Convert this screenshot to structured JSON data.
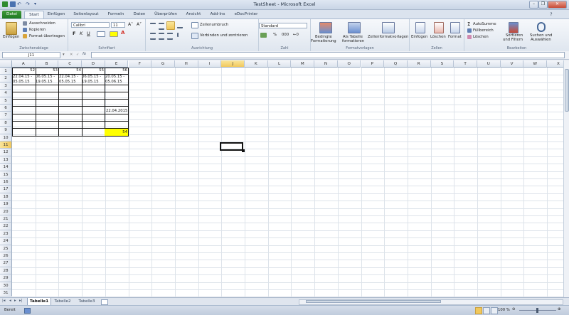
{
  "window": {
    "title": "TestSheet - Microsoft Excel"
  },
  "tabs": [
    "Datei",
    "Start",
    "Einfügen",
    "Seitenlayout",
    "Formeln",
    "Daten",
    "Überprüfen",
    "Ansicht",
    "Add-Ins",
    "eDocPrinter"
  ],
  "ribbon": {
    "clipboard": {
      "label": "Zwischenablage",
      "paste": "Einfügen",
      "cut": "Ausschneiden",
      "copy": "Kopieren",
      "format_painter": "Format übertragen"
    },
    "font": {
      "label": "Schriftart",
      "name": "Calibri",
      "size": "11",
      "bold": "F",
      "italic": "K",
      "underline": "U"
    },
    "alignment": {
      "label": "Ausrichtung",
      "wrap": "Zeilenumbruch",
      "merge": "Verbinden und zentrieren"
    },
    "number": {
      "label": "Zahl",
      "format": "Standard",
      "percent": "%",
      "thousands": "000"
    },
    "styles": {
      "label": "Formatvorlagen",
      "cond1": "Bedingte",
      "cond2": "Formatierung",
      "table1": "Als Tabelle",
      "table2": "formatieren",
      "cell": "Zellenformatvorlagen"
    },
    "cells": {
      "label": "Zellen",
      "insert": "Einfügen",
      "delete": "Löschen",
      "format": "Format"
    },
    "editing": {
      "label": "Bearbeiten",
      "autosum": "AutoSumme",
      "fill": "Füllbereich",
      "clear": "Löschen",
      "sort1": "Sortieren",
      "sort2": "und Filtern",
      "find1": "Suchen und",
      "find2": "Auswählen"
    }
  },
  "formula_bar": {
    "name_box": "J11",
    "fx": "fx",
    "content": ""
  },
  "columns": [
    "A",
    "B",
    "C",
    "D",
    "E",
    "F",
    "G",
    "H",
    "I",
    "J",
    "K",
    "L",
    "M",
    "N",
    "O",
    "P",
    "Q",
    "R",
    "S",
    "T",
    "U",
    "V",
    "W",
    "X"
  ],
  "selected_column": "J",
  "rows": [
    "1",
    "2",
    "3",
    "4",
    "5",
    "6",
    "7",
    "8",
    "9",
    "10",
    "11",
    "12",
    "13",
    "14",
    "15",
    "16",
    "17",
    "18",
    "19",
    "20",
    "21",
    "22",
    "23",
    "24",
    "25",
    "26",
    "27",
    "28",
    "29",
    "30",
    "31"
  ],
  "selected_row": "11",
  "cells": {
    "a1": "52",
    "b1": "53",
    "c1": "54",
    "d1": "55",
    "e1": "56",
    "a2_1": "22.04.15 -",
    "a2_2": "05.05.15",
    "b2_1": "06.05.15 -",
    "b2_2": "19.05.15",
    "c2_1": "22.04.15 -",
    "c2_2": "05.05.15",
    "d2_1": "06.05.15 -",
    "d2_2": "19.05.15",
    "e2_1": "20.05.15 -",
    "e2_2": "05.06.15",
    "e6": "22.04.2015",
    "e9": "54"
  },
  "colors": {
    "highlight": "#ffff00",
    "selection_header": "#f1c85c",
    "file_tab": "#2f8a2e"
  },
  "sheet_tabs": [
    "Tabelle1",
    "Tabelle2",
    "Tabelle3"
  ],
  "active_sheet": "Tabelle1",
  "status": {
    "ready": "Bereit",
    "zoom": "100 %"
  }
}
